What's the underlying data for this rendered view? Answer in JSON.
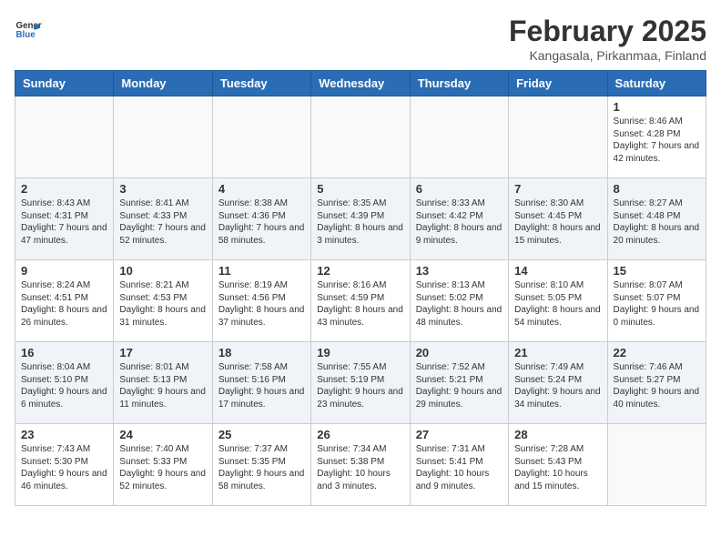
{
  "logo": {
    "general": "General",
    "blue": "Blue"
  },
  "header": {
    "month": "February 2025",
    "location": "Kangasala, Pirkanmaa, Finland"
  },
  "weekdays": [
    "Sunday",
    "Monday",
    "Tuesday",
    "Wednesday",
    "Thursday",
    "Friday",
    "Saturday"
  ],
  "weeks": [
    [
      {
        "day": "",
        "info": ""
      },
      {
        "day": "",
        "info": ""
      },
      {
        "day": "",
        "info": ""
      },
      {
        "day": "",
        "info": ""
      },
      {
        "day": "",
        "info": ""
      },
      {
        "day": "",
        "info": ""
      },
      {
        "day": "1",
        "info": "Sunrise: 8:46 AM\nSunset: 4:28 PM\nDaylight: 7 hours\nand 42 minutes."
      }
    ],
    [
      {
        "day": "2",
        "info": "Sunrise: 8:43 AM\nSunset: 4:31 PM\nDaylight: 7 hours\nand 47 minutes."
      },
      {
        "day": "3",
        "info": "Sunrise: 8:41 AM\nSunset: 4:33 PM\nDaylight: 7 hours\nand 52 minutes."
      },
      {
        "day": "4",
        "info": "Sunrise: 8:38 AM\nSunset: 4:36 PM\nDaylight: 7 hours\nand 58 minutes."
      },
      {
        "day": "5",
        "info": "Sunrise: 8:35 AM\nSunset: 4:39 PM\nDaylight: 8 hours\nand 3 minutes."
      },
      {
        "day": "6",
        "info": "Sunrise: 8:33 AM\nSunset: 4:42 PM\nDaylight: 8 hours\nand 9 minutes."
      },
      {
        "day": "7",
        "info": "Sunrise: 8:30 AM\nSunset: 4:45 PM\nDaylight: 8 hours\nand 15 minutes."
      },
      {
        "day": "8",
        "info": "Sunrise: 8:27 AM\nSunset: 4:48 PM\nDaylight: 8 hours\nand 20 minutes."
      }
    ],
    [
      {
        "day": "9",
        "info": "Sunrise: 8:24 AM\nSunset: 4:51 PM\nDaylight: 8 hours\nand 26 minutes."
      },
      {
        "day": "10",
        "info": "Sunrise: 8:21 AM\nSunset: 4:53 PM\nDaylight: 8 hours\nand 31 minutes."
      },
      {
        "day": "11",
        "info": "Sunrise: 8:19 AM\nSunset: 4:56 PM\nDaylight: 8 hours\nand 37 minutes."
      },
      {
        "day": "12",
        "info": "Sunrise: 8:16 AM\nSunset: 4:59 PM\nDaylight: 8 hours\nand 43 minutes."
      },
      {
        "day": "13",
        "info": "Sunrise: 8:13 AM\nSunset: 5:02 PM\nDaylight: 8 hours\nand 48 minutes."
      },
      {
        "day": "14",
        "info": "Sunrise: 8:10 AM\nSunset: 5:05 PM\nDaylight: 8 hours\nand 54 minutes."
      },
      {
        "day": "15",
        "info": "Sunrise: 8:07 AM\nSunset: 5:07 PM\nDaylight: 9 hours\nand 0 minutes."
      }
    ],
    [
      {
        "day": "16",
        "info": "Sunrise: 8:04 AM\nSunset: 5:10 PM\nDaylight: 9 hours\nand 6 minutes."
      },
      {
        "day": "17",
        "info": "Sunrise: 8:01 AM\nSunset: 5:13 PM\nDaylight: 9 hours\nand 11 minutes."
      },
      {
        "day": "18",
        "info": "Sunrise: 7:58 AM\nSunset: 5:16 PM\nDaylight: 9 hours\nand 17 minutes."
      },
      {
        "day": "19",
        "info": "Sunrise: 7:55 AM\nSunset: 5:19 PM\nDaylight: 9 hours\nand 23 minutes."
      },
      {
        "day": "20",
        "info": "Sunrise: 7:52 AM\nSunset: 5:21 PM\nDaylight: 9 hours\nand 29 minutes."
      },
      {
        "day": "21",
        "info": "Sunrise: 7:49 AM\nSunset: 5:24 PM\nDaylight: 9 hours\nand 34 minutes."
      },
      {
        "day": "22",
        "info": "Sunrise: 7:46 AM\nSunset: 5:27 PM\nDaylight: 9 hours\nand 40 minutes."
      }
    ],
    [
      {
        "day": "23",
        "info": "Sunrise: 7:43 AM\nSunset: 5:30 PM\nDaylight: 9 hours\nand 46 minutes."
      },
      {
        "day": "24",
        "info": "Sunrise: 7:40 AM\nSunset: 5:33 PM\nDaylight: 9 hours\nand 52 minutes."
      },
      {
        "day": "25",
        "info": "Sunrise: 7:37 AM\nSunset: 5:35 PM\nDaylight: 9 hours\nand 58 minutes."
      },
      {
        "day": "26",
        "info": "Sunrise: 7:34 AM\nSunset: 5:38 PM\nDaylight: 10 hours\nand 3 minutes."
      },
      {
        "day": "27",
        "info": "Sunrise: 7:31 AM\nSunset: 5:41 PM\nDaylight: 10 hours\nand 9 minutes."
      },
      {
        "day": "28",
        "info": "Sunrise: 7:28 AM\nSunset: 5:43 PM\nDaylight: 10 hours\nand 15 minutes."
      },
      {
        "day": "",
        "info": ""
      }
    ]
  ]
}
